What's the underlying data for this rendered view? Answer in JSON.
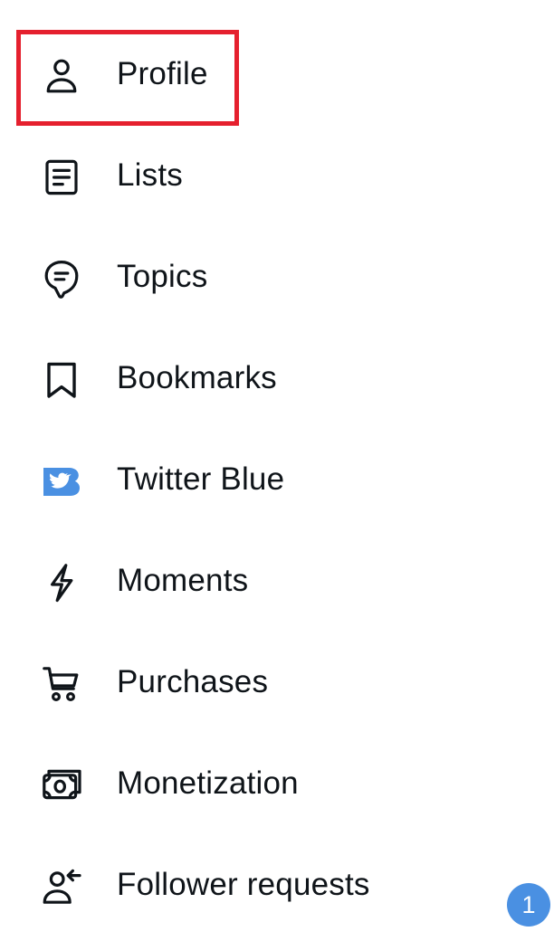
{
  "menu": {
    "items": [
      {
        "label": "Profile",
        "icon": "profile-icon"
      },
      {
        "label": "Lists",
        "icon": "lists-icon"
      },
      {
        "label": "Topics",
        "icon": "topics-icon"
      },
      {
        "label": "Bookmarks",
        "icon": "bookmark-icon"
      },
      {
        "label": "Twitter Blue",
        "icon": "twitter-blue-icon"
      },
      {
        "label": "Moments",
        "icon": "lightning-icon"
      },
      {
        "label": "Purchases",
        "icon": "cart-icon"
      },
      {
        "label": "Monetization",
        "icon": "money-icon"
      },
      {
        "label": "Follower requests",
        "icon": "follower-requests-icon",
        "badge": "1"
      }
    ]
  },
  "highlighted_item": "Profile",
  "colors": {
    "text": "#0f1419",
    "highlight": "#e5202e",
    "twitter_blue": "#4a90e2",
    "badge": "#4a90e2"
  }
}
